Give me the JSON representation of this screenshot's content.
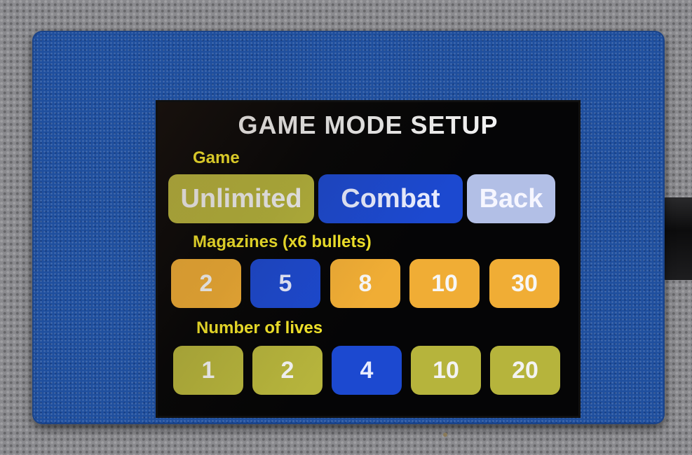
{
  "screen": {
    "title": "GAME MODE SETUP"
  },
  "game_section": {
    "label": "Game",
    "buttons": [
      {
        "label": "Unlimited",
        "selected": false,
        "color": "#b6b43c"
      },
      {
        "label": "Combat",
        "selected": true,
        "color": "#1c49d0"
      },
      {
        "label": "Back",
        "selected": false,
        "color": "#b2bfe6"
      }
    ]
  },
  "magazines_section": {
    "label": "Magazines (x6 bullets)",
    "options": [
      {
        "label": "2",
        "selected": false
      },
      {
        "label": "5",
        "selected": true
      },
      {
        "label": "8",
        "selected": false
      },
      {
        "label": "10",
        "selected": false
      },
      {
        "label": "30",
        "selected": false
      }
    ],
    "option_color": "#f0ad35",
    "selected_color": "#1c49d0"
  },
  "lives_section": {
    "label": "Number of lives",
    "options": [
      {
        "label": "1",
        "selected": false
      },
      {
        "label": "2",
        "selected": false
      },
      {
        "label": "4",
        "selected": true
      },
      {
        "label": "10",
        "selected": false
      },
      {
        "label": "20",
        "selected": false
      }
    ],
    "option_color": "#b6b43c",
    "selected_color": "#1c49d0"
  },
  "colors": {
    "label_yellow": "#f4e62a",
    "title_white": "#f2f2f2",
    "device_blue": "#1f4f9e",
    "screen_black": "#050506"
  }
}
